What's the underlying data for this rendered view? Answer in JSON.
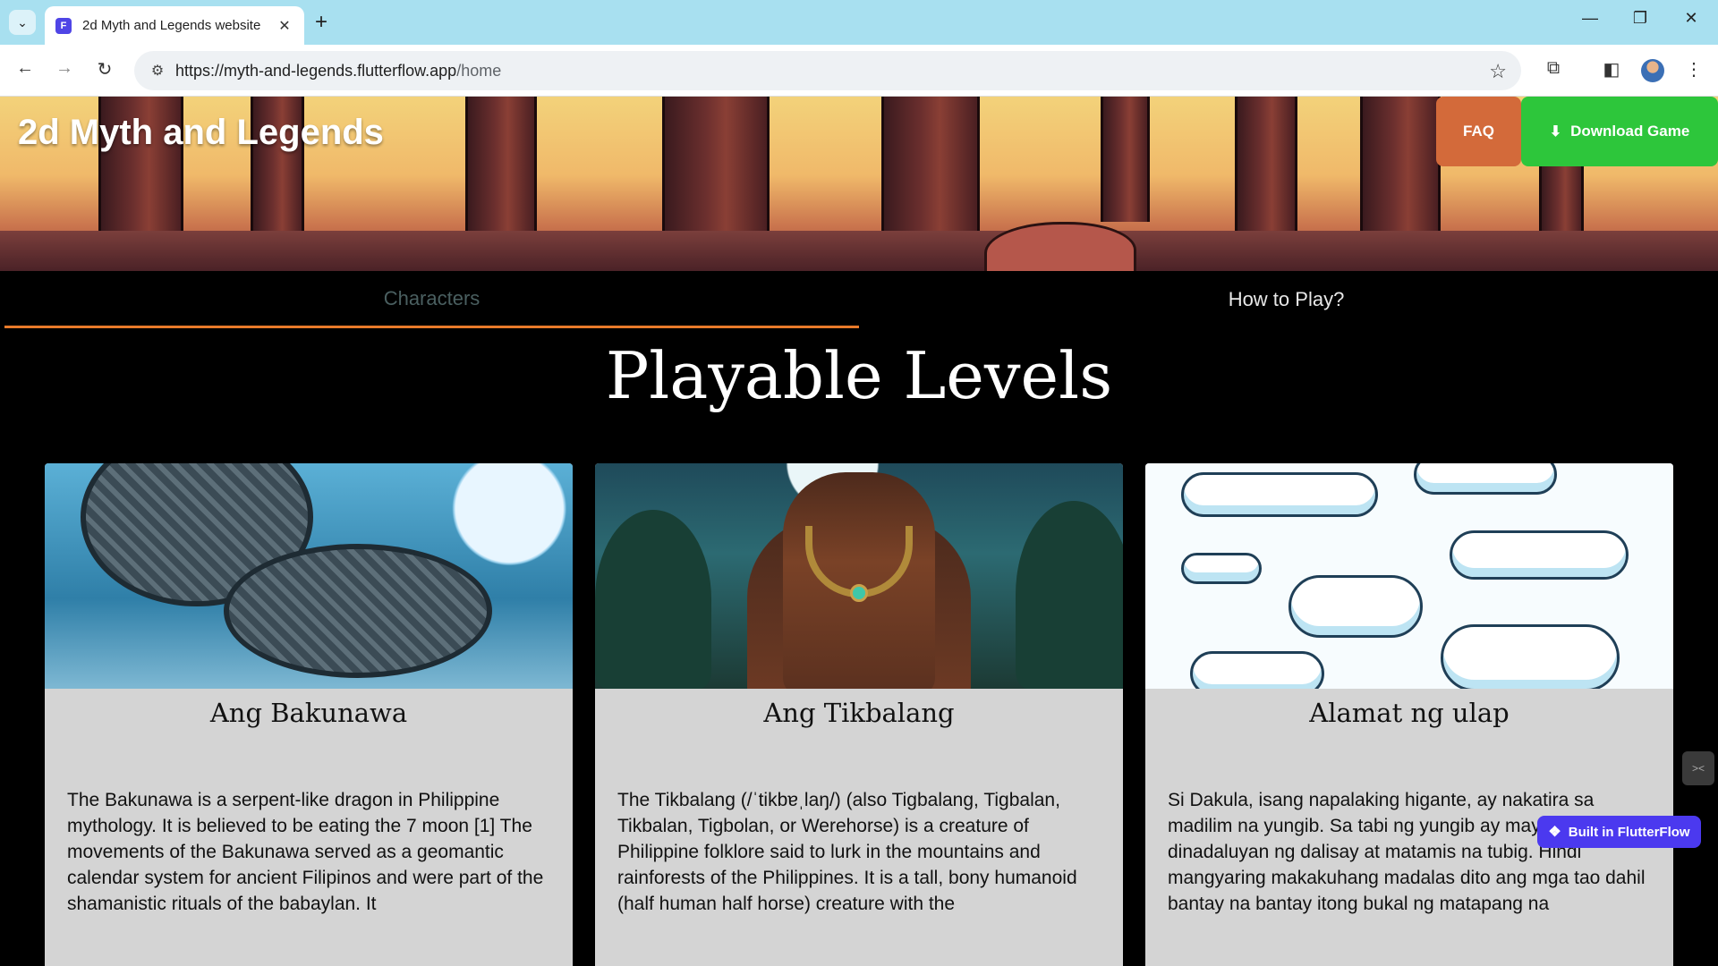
{
  "browser": {
    "tab_title": "2d Myth and Legends website",
    "url_host": "https://myth-and-legends.flutterflow.app",
    "url_path": "/home"
  },
  "header": {
    "site_title": "2d Myth and Legends",
    "faq_label": "FAQ",
    "download_label": "Download Game"
  },
  "tabs": [
    {
      "label": "Characters",
      "active": true
    },
    {
      "label": "How to Play?",
      "active": false
    }
  ],
  "main": {
    "heading": "Playable Levels",
    "cards": [
      {
        "title": "Ang Bakunawa",
        "text": "The Bakunawa is a serpent-like dragon in Philippine mythology. It is believed to be eating the 7 moon  [1] The movements of the Bakunawa served as a geomantic calendar system for ancient Filipinos and were part of the shamanistic rituals of the babaylan. It"
      },
      {
        "title": "Ang Tikbalang",
        "text": "The Tikbalang (/ˈtikbɐˌlaŋ/) (also Tigbalang, Tigbalan, Tikbalan, Tigbolan, or Werehorse) is a creature of Philippine folklore said to lurk in the mountains and rainforests of the Philippines. It is a tall, bony humanoid (half human half horse) creature with the"
      },
      {
        "title": "Alamat ng ulap",
        "text": "Si Dakula, isang napalaking higante, ay nakatira sa madilim na yungib. Sa tabi ng yungib ay may bukal na dinadaluyan ng dalisay at matamis na tubig. Hindi mangyaring makakuhang madalas dito ang mga tao dahil bantay na bantay itong bukal ng matapang na"
      }
    ]
  },
  "badge": {
    "label": "Built in FlutterFlow"
  },
  "colors": {
    "tabbar": "#a8e0f0",
    "faq_button": "#d36a3a",
    "download_button": "#2dc63b",
    "active_tab_indicator": "#e87a2a",
    "flutterflow_badge": "#4b39ef",
    "card_background": "#d4d4d4"
  }
}
